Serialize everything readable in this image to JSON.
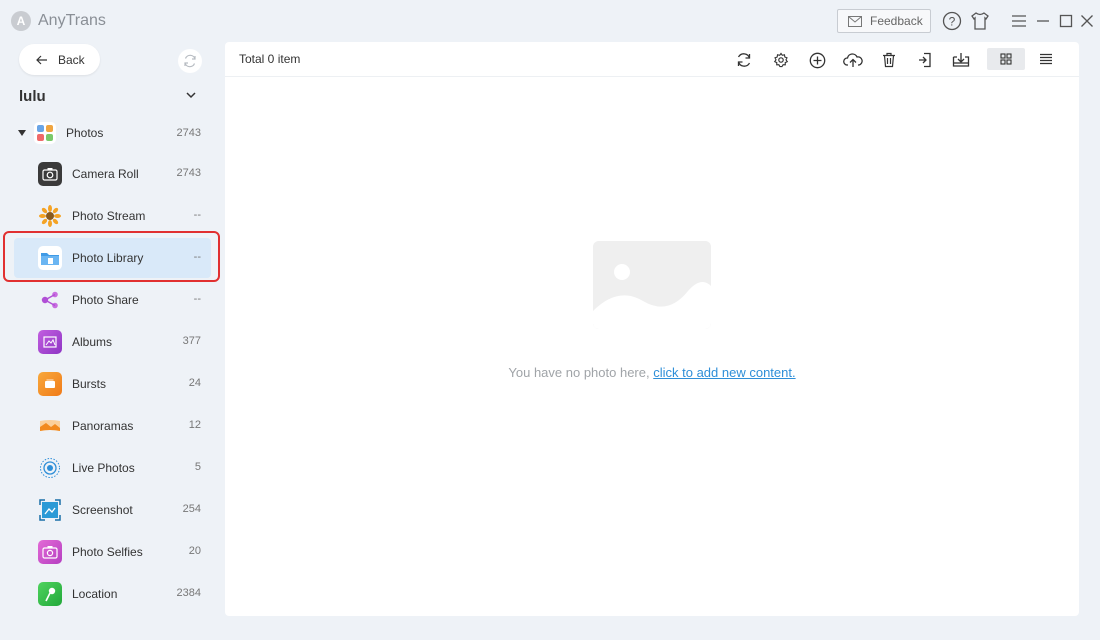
{
  "app": {
    "title": "AnyTrans",
    "logo_glyph": "A"
  },
  "titlebar": {
    "feedback_label": "Feedback",
    "icons": [
      "help-icon",
      "skin-icon",
      "menu-icon",
      "minimize-icon",
      "maximize-icon",
      "close-icon"
    ]
  },
  "sidebar": {
    "back_label": "Back",
    "device_name": "lulu",
    "category": {
      "label": "Photos",
      "count": "2743"
    },
    "items": [
      {
        "label": "Camera Roll",
        "count": "2743",
        "icon": "camera-icon",
        "color": "#3a3a3a"
      },
      {
        "label": "Photo Stream",
        "count": "--",
        "icon": "sunflower-icon",
        "color": "#f4a325"
      },
      {
        "label": "Photo Library",
        "count": "--",
        "icon": "folder-icon",
        "color": "#2f8fd8"
      },
      {
        "label": "Photo Share",
        "count": "--",
        "icon": "share-icon",
        "color": "#b04fd6"
      },
      {
        "label": "Albums",
        "count": "377",
        "icon": "albums-icon",
        "color": "#a540c9"
      },
      {
        "label": "Bursts",
        "count": "24",
        "icon": "bursts-icon",
        "color": "#f28a1d"
      },
      {
        "label": "Panoramas",
        "count": "12",
        "icon": "panorama-icon",
        "color": "#f49a3c"
      },
      {
        "label": "Live Photos",
        "count": "5",
        "icon": "live-photo-icon",
        "color": "#2f8fd8"
      },
      {
        "label": "Screenshot",
        "count": "254",
        "icon": "screenshot-icon",
        "color": "#2b9ad6"
      },
      {
        "label": "Photo Selfies",
        "count": "20",
        "icon": "selfie-icon",
        "color": "#d04fc7"
      },
      {
        "label": "Location",
        "count": "2384",
        "icon": "location-icon",
        "color": "#35c04a"
      }
    ],
    "selected_index": 2
  },
  "main": {
    "total_label": "Total 0 item",
    "toolbar_icons": [
      "refresh-icon",
      "settings-icon",
      "add-icon",
      "upload-cloud-icon",
      "trash-icon",
      "export-to-pc-icon",
      "export-to-device-icon",
      "grid-view-icon",
      "list-view-icon"
    ],
    "empty_message": "You have no photo here,",
    "empty_link": "click to add new content."
  },
  "colors": {
    "accent": "#2f8fd8",
    "highlight": "#e13030",
    "selected_bg": "#d9e9f9"
  }
}
